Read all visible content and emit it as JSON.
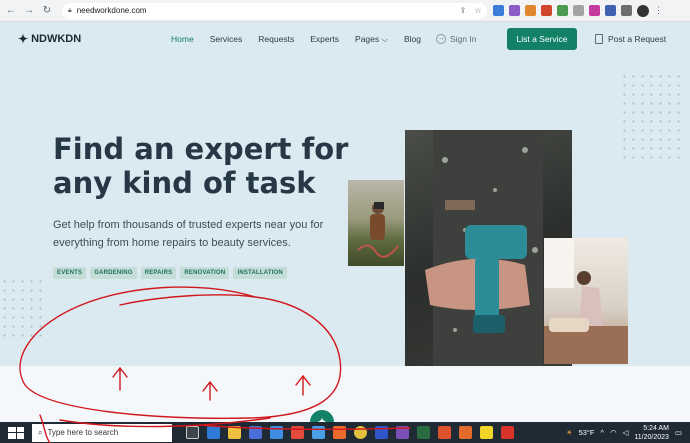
{
  "browser": {
    "url": "needworkdone.com",
    "nav": {
      "back": "←",
      "forward": "→",
      "reload": "↻"
    }
  },
  "header": {
    "logo_text": "NDWKDN",
    "nav": [
      {
        "label": "Home",
        "active": true
      },
      {
        "label": "Services",
        "active": false
      },
      {
        "label": "Requests",
        "active": false
      },
      {
        "label": "Experts",
        "active": false
      },
      {
        "label": "Pages ⌵",
        "active": false
      },
      {
        "label": "Blog",
        "active": false
      }
    ],
    "sign_in": "Sign In",
    "cta": "List a Service",
    "post_request": "Post a Request"
  },
  "hero": {
    "title": "Find an expert for any kind of task",
    "subtitle": "Get help from thousands of trusted experts near you for everything from home repairs to beauty services.",
    "tags": [
      "EVENTS",
      "GARDENING",
      "REPAIRS",
      "RENOVATION",
      "INSTALLATION"
    ]
  },
  "taskbar": {
    "search_placeholder": "Type here to search",
    "weather": "53°F",
    "time": "5:24 AM",
    "date": "11/20/2023"
  },
  "colors": {
    "accent": "#138068",
    "background": "#dbe9f1",
    "annotation": "#d0181c"
  }
}
